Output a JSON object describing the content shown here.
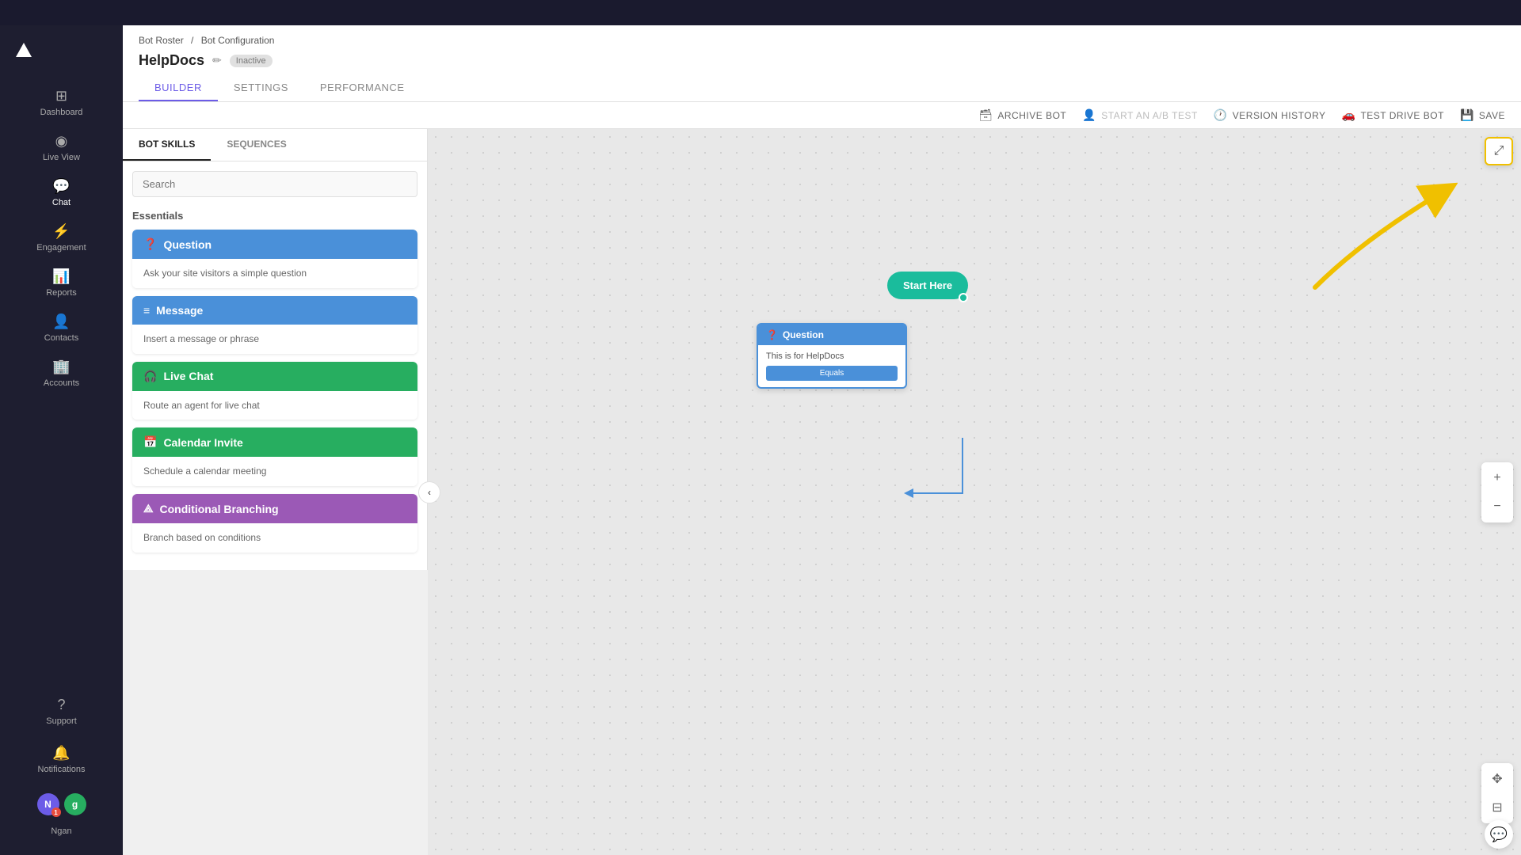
{
  "app": {
    "title": "Bot Configuration"
  },
  "sidebar": {
    "logo": "▲",
    "items": [
      {
        "id": "dashboard",
        "label": "Dashboard",
        "icon": "⊞"
      },
      {
        "id": "live-view",
        "label": "Live View",
        "icon": "👁"
      },
      {
        "id": "chat",
        "label": "Chat",
        "icon": "💬"
      },
      {
        "id": "engagement",
        "label": "Engagement",
        "icon": "⚡"
      },
      {
        "id": "reports",
        "label": "Reports",
        "icon": "📊"
      },
      {
        "id": "contacts",
        "label": "Contacts",
        "icon": "👤"
      },
      {
        "id": "accounts",
        "label": "Accounts",
        "icon": "🏢"
      }
    ],
    "bottom": {
      "support_label": "Support",
      "notifications_label": "Notifications",
      "user_name": "Ngan",
      "user_initial": "N",
      "user_badge": "1",
      "user_letter": "g"
    }
  },
  "breadcrumb": {
    "parent": "Bot Roster",
    "current": "Bot Configuration"
  },
  "page": {
    "title": "HelpDocs",
    "status": "Inactive"
  },
  "tabs": {
    "items": [
      {
        "id": "builder",
        "label": "BUILDER",
        "active": true
      },
      {
        "id": "settings",
        "label": "SETTINGS",
        "active": false
      },
      {
        "id": "performance",
        "label": "PERFORMANCE",
        "active": false
      }
    ]
  },
  "toolbar": {
    "archive_label": "ARCHIVE BOT",
    "ab_test_label": "START AN A/B TEST",
    "version_label": "VERSION HISTORY",
    "test_drive_label": "TEST DRIVE BOT",
    "save_label": "SAVE"
  },
  "panel_tabs": {
    "bot_skills": "BOT SKILLS",
    "sequences": "SEQUENCES"
  },
  "search": {
    "placeholder": "Search"
  },
  "skills": {
    "section_title": "Essentials",
    "items": [
      {
        "id": "question",
        "title": "Question",
        "description": "Ask your site visitors a simple question",
        "color": "blue",
        "icon": "?"
      },
      {
        "id": "message",
        "title": "Message",
        "description": "Insert a message or phrase",
        "color": "blue",
        "icon": "≡"
      },
      {
        "id": "live-chat",
        "title": "Live Chat",
        "description": "Route an agent for live chat",
        "color": "green",
        "icon": "🎧"
      },
      {
        "id": "calendar-invite",
        "title": "Calendar Invite",
        "description": "Schedule a calendar meeting",
        "color": "green",
        "icon": "📅"
      },
      {
        "id": "conditional-branching",
        "title": "Conditional Branching",
        "description": "Branch based on conditions",
        "color": "purple",
        "icon": "⟁"
      }
    ]
  },
  "canvas": {
    "start_node_label": "Start Here",
    "question_node": {
      "title": "Question",
      "body": "This is for HelpDocs",
      "button": "Equals"
    }
  },
  "canvas_tools": {
    "zoom_in": "+",
    "zoom_out": "−",
    "fit": "⊡",
    "expand": "⤢"
  }
}
